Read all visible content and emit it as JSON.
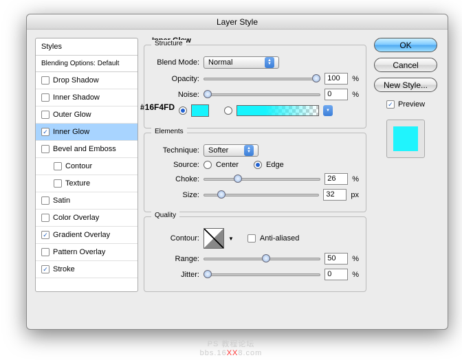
{
  "window": {
    "title": "Layer Style"
  },
  "sidebar": {
    "header": "Styles",
    "subheader": "Blending Options: Default",
    "items": [
      {
        "label": "Drop Shadow",
        "checked": false,
        "selected": false,
        "indent": false
      },
      {
        "label": "Inner Shadow",
        "checked": false,
        "selected": false,
        "indent": false
      },
      {
        "label": "Outer Glow",
        "checked": false,
        "selected": false,
        "indent": false
      },
      {
        "label": "Inner Glow",
        "checked": true,
        "selected": true,
        "indent": false
      },
      {
        "label": "Bevel and Emboss",
        "checked": false,
        "selected": false,
        "indent": false
      },
      {
        "label": "Contour",
        "checked": false,
        "selected": false,
        "indent": true
      },
      {
        "label": "Texture",
        "checked": false,
        "selected": false,
        "indent": true
      },
      {
        "label": "Satin",
        "checked": false,
        "selected": false,
        "indent": false
      },
      {
        "label": "Color Overlay",
        "checked": false,
        "selected": false,
        "indent": false
      },
      {
        "label": "Gradient Overlay",
        "checked": true,
        "selected": false,
        "indent": false
      },
      {
        "label": "Pattern Overlay",
        "checked": false,
        "selected": false,
        "indent": false
      },
      {
        "label": "Stroke",
        "checked": true,
        "selected": false,
        "indent": false
      }
    ]
  },
  "panel": {
    "title": "Inner Glow",
    "structure": {
      "legend": "Structure",
      "blend_mode_label": "Blend Mode:",
      "blend_mode_value": "Normal",
      "opacity_label": "Opacity:",
      "opacity_value": "100",
      "opacity_unit": "%",
      "noise_label": "Noise:",
      "noise_value": "0",
      "noise_unit": "%",
      "color_hex": "#16F4FD",
      "color_swatch": "#16F4FD",
      "fill_type": "solid"
    },
    "elements": {
      "legend": "Elements",
      "technique_label": "Technique:",
      "technique_value": "Softer",
      "source_label": "Source:",
      "source_center": "Center",
      "source_edge": "Edge",
      "source_value": "Edge",
      "choke_label": "Choke:",
      "choke_value": "26",
      "choke_unit": "%",
      "size_label": "Size:",
      "size_value": "32",
      "size_unit": "px"
    },
    "quality": {
      "legend": "Quality",
      "contour_label": "Contour:",
      "anti_alias_label": "Anti-aliased",
      "anti_alias_checked": false,
      "range_label": "Range:",
      "range_value": "50",
      "range_unit": "%",
      "jitter_label": "Jitter:",
      "jitter_value": "0",
      "jitter_unit": "%"
    }
  },
  "buttons": {
    "ok": "OK",
    "cancel": "Cancel",
    "new_style": "New Style...",
    "preview_label": "Preview",
    "preview_checked": true,
    "preview_color": "#20f4fd"
  },
  "footer": {
    "line1": "PS 教程论坛",
    "line2_pre": "bbs.16",
    "line2_mid": "XX",
    "line2_post": "8.com"
  }
}
